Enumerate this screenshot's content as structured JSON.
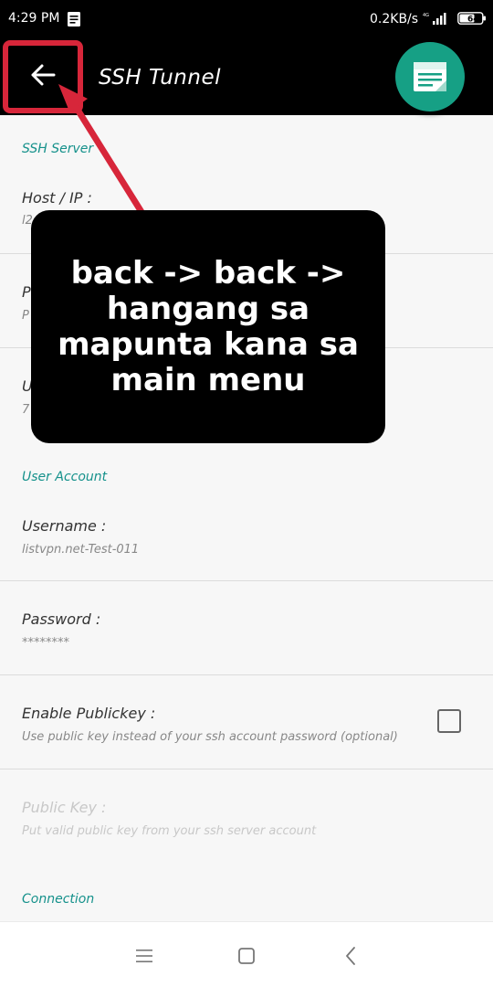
{
  "status_bar": {
    "time": "4:29 PM",
    "network_speed": "0.2KB/s",
    "battery": "64",
    "icons": [
      "notes-icon",
      "signal-icon",
      "battery-icon"
    ]
  },
  "app_bar": {
    "title": "SSH Tunnel",
    "back_icon": "arrow-left-icon",
    "fab_icon": "note-icon",
    "fab_color": "#16a085"
  },
  "sections": {
    "ssh_server": {
      "header": "SSH Server",
      "host_label": "Host / IP :",
      "host_value": "l2",
      "port_label": "P",
      "port_value": "P",
      "udp_label": "U",
      "udp_value": "7"
    },
    "user_account": {
      "header": "User Account",
      "username_label": "Username :",
      "username_value": "listvpn.net-Test-011",
      "password_label": "Password :",
      "password_value": "********",
      "publickey_label": "Enable Publickey :",
      "publickey_desc": "Use public key instead of your ssh account password (optional)",
      "publickey_checked": false,
      "pubkey_label": "Public Key :",
      "pubkey_desc": "Put valid public key from your ssh server account"
    },
    "connection": {
      "header": "Connection"
    }
  },
  "overlay": {
    "text": "back -> back -> hangang sa mapunta kana sa main menu",
    "highlight_color": "#d7263a"
  },
  "nav_bar": {
    "icons": [
      "menu-icon",
      "home-square-icon",
      "back-chevron-icon"
    ]
  }
}
